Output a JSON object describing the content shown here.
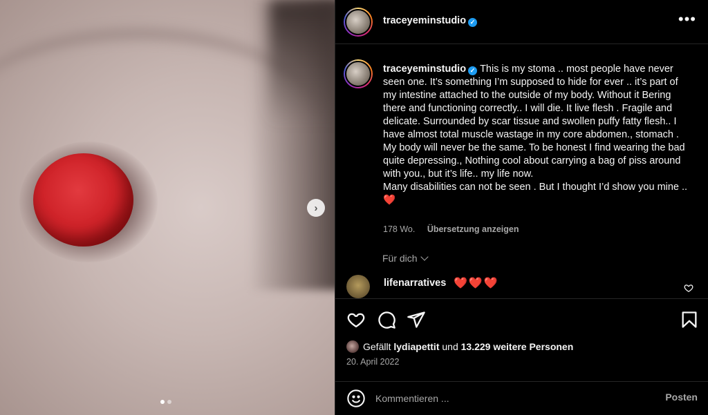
{
  "post": {
    "username": "traceyeminstudio",
    "verified_mark": "✓",
    "more_label": "•••"
  },
  "caption": {
    "username": "traceyeminstudio",
    "text": "This is my stoma .. most people have never seen one. It’s something I’m supposed to hide for ever .. it’s part of my intestine attached to the outside of my body. Without it Bering there and functioning correctly.. I will die. It live flesh . Fragile and delicate. Surrounded by scar tissue and swollen puffy fatty flesh.. I have almost total muscle wastage in my core abdomen., stomach . My body will never be the same. To be honest I find wearing the bad quite depressing., Nothing cool about carrying a bag of piss around with you., but it’s life.. my life now.\nMany disabilities can not be seen . But I thought I’d show you mine .. ",
    "heart": "❤️",
    "time": "178 Wo.",
    "translate_label": "Übersetzung anzeigen"
  },
  "for_you_label": "Für dich",
  "comment": {
    "username": "lifenarratives",
    "text": "❤️❤️❤️"
  },
  "likes": {
    "prefix": "Gefällt",
    "user": "lydiapettit",
    "connector": "und",
    "count_text": "13.229 weitere Personen"
  },
  "date": "20. April 2022",
  "add_comment": {
    "placeholder": "Kommentieren ...",
    "post_label": "Posten"
  },
  "media": {
    "next_label": "›",
    "carousel_total": 2,
    "carousel_active": 1
  },
  "colors": {
    "background": "#000000",
    "text": "#f5f5f5",
    "secondary_text": "#a8a8a8",
    "verified": "#1d9bf0",
    "heart": "#e0303a"
  }
}
